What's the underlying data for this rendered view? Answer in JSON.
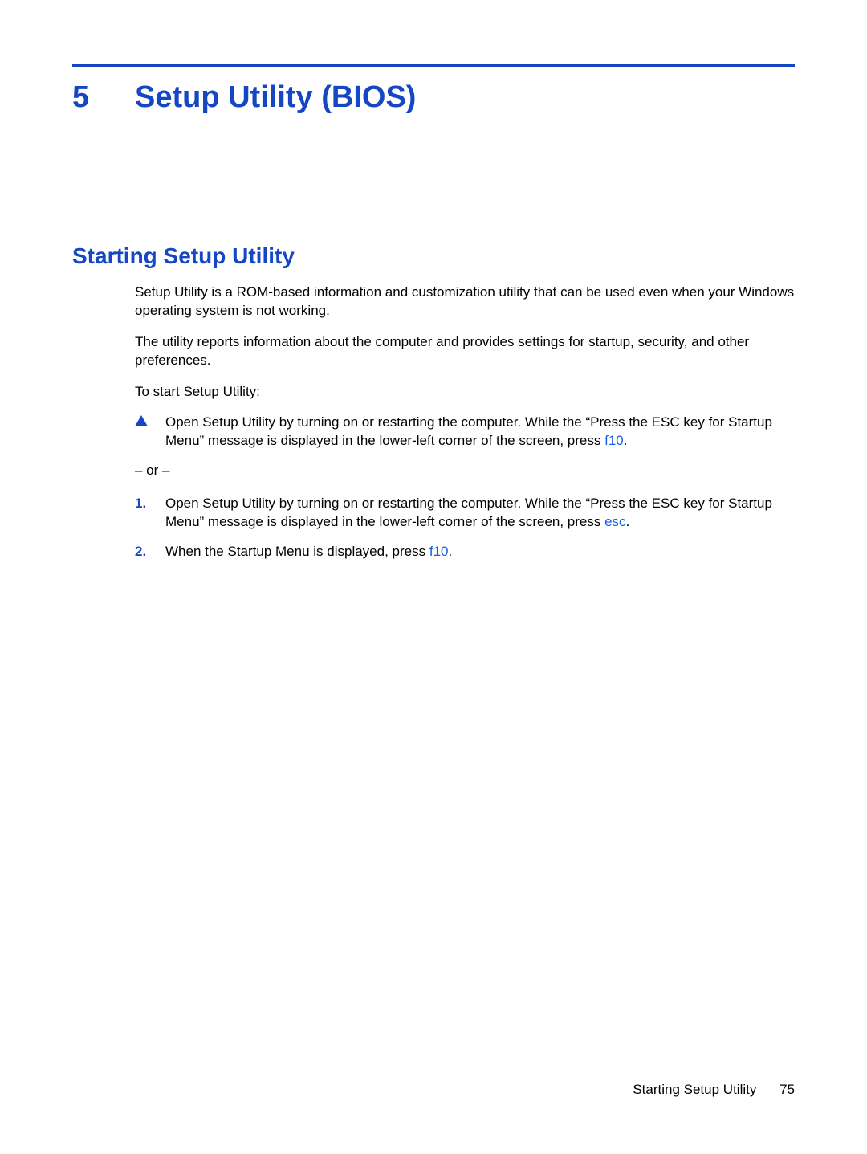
{
  "chapter": {
    "number": "5",
    "title": "Setup Utility (BIOS)"
  },
  "section": {
    "title": "Starting Setup Utility"
  },
  "paragraphs": {
    "p1": "Setup Utility is a ROM-based information and customization utility that can be used even when your Windows operating system is not working.",
    "p2": "The utility reports information about the computer and provides settings for startup, security, and other preferences.",
    "p3": "To start Setup Utility:"
  },
  "bullet": {
    "text_a": "Open Setup Utility by turning on or restarting the computer. While the “Press the ESC key for Startup Menu” message is displayed in the lower-left corner of the screen, press ",
    "key": "f10",
    "text_b": "."
  },
  "or_text": "– or –",
  "steps": {
    "s1": {
      "num": "1.",
      "text_a": "Open Setup Utility by turning on or restarting the computer. While the “Press the ESC key for Startup Menu” message is displayed in the lower-left corner of the screen, press ",
      "key": "esc",
      "text_b": "."
    },
    "s2": {
      "num": "2.",
      "text_a": "When the Startup Menu is displayed, press ",
      "key": "f10",
      "text_b": "."
    }
  },
  "footer": {
    "title": "Starting Setup Utility",
    "page": "75"
  }
}
